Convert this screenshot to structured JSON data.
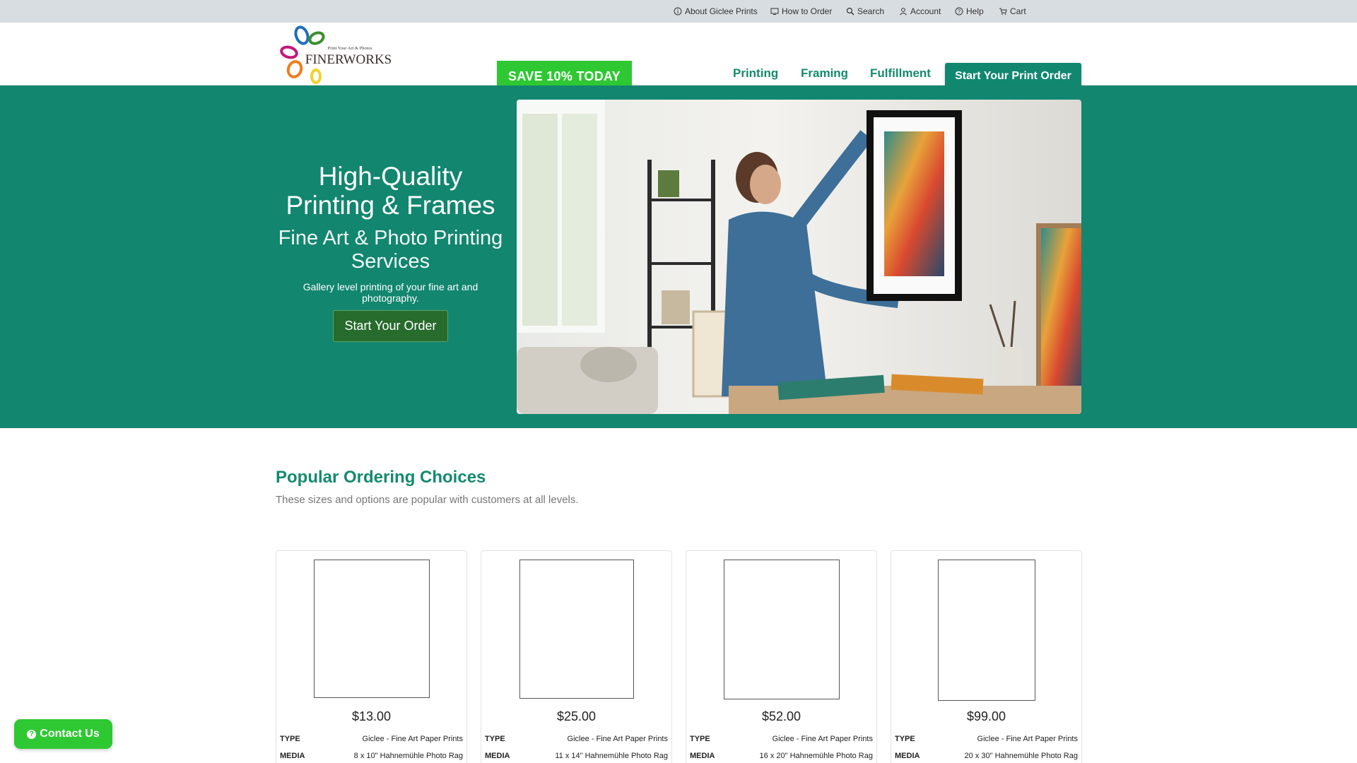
{
  "topbar": {
    "items": [
      {
        "label": "About Giclee Prints",
        "icon": "info-icon"
      },
      {
        "label": "How to Order",
        "icon": "monitor-icon"
      },
      {
        "label": "Search",
        "icon": "search-icon"
      },
      {
        "label": "Account",
        "icon": "user-icon"
      },
      {
        "label": "Help",
        "icon": "help-icon"
      },
      {
        "label": "Cart",
        "icon": "cart-icon"
      }
    ]
  },
  "header": {
    "logo_text": "FINERWORKS",
    "logo_tagline": "Print Your Art & Photos",
    "save_label": "SAVE 10% TODAY",
    "nav": [
      "Printing",
      "Framing",
      "Fulfillment"
    ],
    "cta_label": "Start Your Print Order"
  },
  "hero": {
    "title": "High-Quality Printing & Frames",
    "subtitle": "Fine Art & Photo Printing Services",
    "description": "Gallery level printing of your fine art and photography.",
    "button_label": "Start Your Order"
  },
  "popular": {
    "title": "Popular Ordering Choices",
    "subtitle": "These sizes and options are popular with customers at all levels.",
    "type_key": "TYPE",
    "media_key": "MEDIA",
    "cards": [
      {
        "price": "$13.00",
        "type": "Giclee - Fine Art Paper Prints",
        "media": "8 x 10\" Hahnemühle Photo Rag"
      },
      {
        "price": "$25.00",
        "type": "Giclee - Fine Art Paper Prints",
        "media": "11 x 14\" Hahnemühle Photo Rag"
      },
      {
        "price": "$52.00",
        "type": "Giclee - Fine Art Paper Prints",
        "media": "16 x 20\" Hahnemühle Photo Rag"
      },
      {
        "price": "$99.00",
        "type": "Giclee - Fine Art Paper Prints",
        "media": "20 x 30\" Hahnemühle Photo Rag"
      }
    ]
  },
  "contact": {
    "label": "Contact Us"
  },
  "colors": {
    "brand_green": "#11876f",
    "accent_green": "#2ec833",
    "topbar_bg": "#d8dde1"
  }
}
